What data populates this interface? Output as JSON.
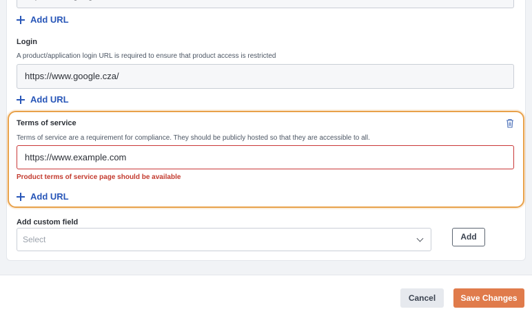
{
  "top_section": {
    "input_value": "https://www.google.com/",
    "add_url_label": "Add URL"
  },
  "login": {
    "title": "Login",
    "description": "A product/application login URL is required to ensure that product access is restricted",
    "input_value": "https://www.google.cza/",
    "add_url_label": "Add URL"
  },
  "terms_of_service": {
    "title": "Terms of service",
    "description": "Terms of service are a requirement for compliance. They should be publicly hosted so that they are accessible to all.",
    "input_value": "https://www.example.com",
    "error": "Product terms of service page should be available",
    "add_url_label": "Add URL",
    "delete_icon": "trash-icon",
    "highlight_color": "#e8a14a",
    "error_color": "#c33a2e"
  },
  "custom_field": {
    "title": "Add custom field",
    "placeholder": "Select",
    "add_button": "Add"
  },
  "footer": {
    "cancel_label": "Cancel",
    "save_label": "Save Changes",
    "save_color": "#e07b4b"
  }
}
